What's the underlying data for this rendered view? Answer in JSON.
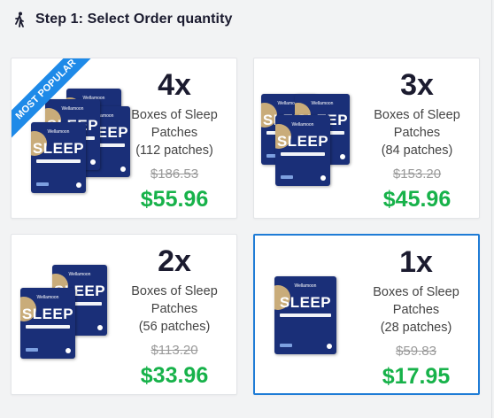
{
  "header": {
    "title": "Step 1: Select Order quantity",
    "icon": "walking-person-icon"
  },
  "ribbon": "MOST POPULAR",
  "package": {
    "brand": "Wellamoon",
    "word": "SLEEP"
  },
  "options": [
    {
      "qty": "4x",
      "desc1": "Boxes of Sleep",
      "desc2": "Patches",
      "desc3": "(112 patches)",
      "old": "$186.53",
      "price": "$55.96"
    },
    {
      "qty": "3x",
      "desc1": "Boxes of Sleep",
      "desc2": "Patches",
      "desc3": "(84 patches)",
      "old": "$153.20",
      "price": "$45.96"
    },
    {
      "qty": "2x",
      "desc1": "Boxes of Sleep",
      "desc2": "Patches",
      "desc3": "(56 patches)",
      "old": "$113.20",
      "price": "$33.96"
    },
    {
      "qty": "1x",
      "desc1": "Boxes of Sleep",
      "desc2": "Patches",
      "desc3": "(28 patches)",
      "old": "$59.83",
      "price": "$17.95"
    }
  ],
  "colors": {
    "price": "#17b24a",
    "accent": "#1f7cd6",
    "ribbon": "#1e8ae8"
  }
}
